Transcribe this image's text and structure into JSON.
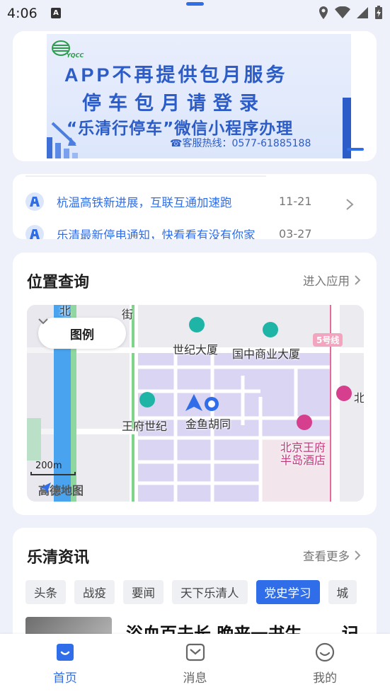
{
  "status_bar": {
    "time": "4:06",
    "notification_glyph": "A"
  },
  "banner": {
    "logo_text": "YQCC",
    "line1": "APP不再提供包月服务",
    "line2": "停车包月请登录",
    "line3": "“乐清行停车”微信小程序办理",
    "hotline": "☎客服热线：0577-61885188"
  },
  "ticker": {
    "items": [
      {
        "title": "杭温高铁新进展，互联互通加速跑",
        "date": "11-21"
      },
      {
        "title": "乐清最新停电通知，快看看有没有你家",
        "date": "03-27"
      }
    ]
  },
  "location": {
    "title": "位置查询",
    "link": "进入应用",
    "legend_label": "图例",
    "scale": "200m",
    "map_provider": "高德地图",
    "line_badge": "5号线",
    "places": {
      "p1": "世纪大厦",
      "p2": "国中商业大厦",
      "p3": "王府世纪",
      "p4": "金鱼胡同",
      "p5": "北京王府",
      "p6": "半岛酒店",
      "street": "北大街",
      "street2": "街",
      "edge_north": "北"
    }
  },
  "news": {
    "title": "乐清资讯",
    "link": "查看更多",
    "tabs": [
      "头条",
      "战疫",
      "要闻",
      "天下乐清人",
      "党史学习",
      "城"
    ],
    "active_tab": 4,
    "article_title": "浴血百夫长 晚来一书生 ——记"
  },
  "nav": {
    "items": [
      {
        "label": "首页",
        "icon": "home-icon"
      },
      {
        "label": "消息",
        "icon": "message-icon"
      },
      {
        "label": "我的",
        "icon": "profile-icon"
      }
    ],
    "active": 0
  },
  "colors": {
    "accent": "#2f6ee8",
    "background": "#eef1f9"
  }
}
